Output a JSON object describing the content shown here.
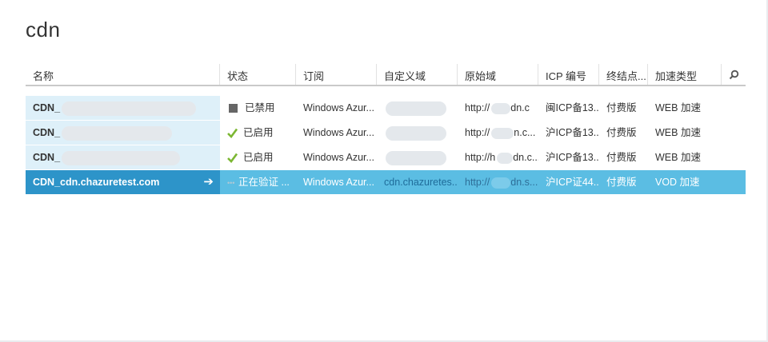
{
  "page": {
    "title": "cdn"
  },
  "columns": {
    "name": "名称",
    "status": "状态",
    "subscription": "订阅",
    "custom_domain": "自定义域",
    "origin_domain": "原始域",
    "icp": "ICP 编号",
    "endpoint": "终结点...",
    "accel_type": "加速类型"
  },
  "icons": {
    "search": "search-icon",
    "check": "checkmark-icon",
    "stop": "stopped-square-icon",
    "arrow": "arrow-right-icon",
    "progress": "progress-dots-icon"
  },
  "colors": {
    "accent": "#2d94c9",
    "selected_row": "#5bbde3",
    "name_cell": "#def0f9",
    "check_green": "#7cb733",
    "link": "#3a86c7"
  },
  "rows": [
    {
      "name": "CDN_",
      "status": "已禁用",
      "status_type": "disabled",
      "subscription": "Windows Azur...",
      "custom_domain": "",
      "origin_domain_prefix": "http://",
      "origin_domain_suffix": "dn.c",
      "icp": "闽ICP备13...",
      "endpoint": "付费版",
      "accel_type": "WEB 加速"
    },
    {
      "name": "CDN_",
      "status": "已启用",
      "status_type": "enabled",
      "subscription": "Windows Azur...",
      "custom_domain": "",
      "origin_domain_prefix": "http://",
      "origin_domain_suffix": "n.c...",
      "icp": "沪ICP备13...",
      "endpoint": "付费版",
      "accel_type": "WEB 加速"
    },
    {
      "name": "CDN_",
      "status": "已启用",
      "status_type": "enabled",
      "subscription": "Windows Azur...",
      "custom_domain": "",
      "origin_domain_prefix": "http://h",
      "origin_domain_suffix": "dn.c...",
      "icp": "沪ICP备13...",
      "endpoint": "付费版",
      "accel_type": "WEB 加速"
    },
    {
      "name": "CDN_cdn.chazuretest.com",
      "status": "正在验证 ...",
      "status_type": "verifying",
      "subscription": "Windows Azur...",
      "custom_domain": "cdn.chazuretes...",
      "origin_domain_prefix": "http://",
      "origin_domain_suffix": "dn.s...",
      "icp": "沪ICP证44...",
      "endpoint": "付费版",
      "accel_type": "VOD 加速"
    }
  ]
}
